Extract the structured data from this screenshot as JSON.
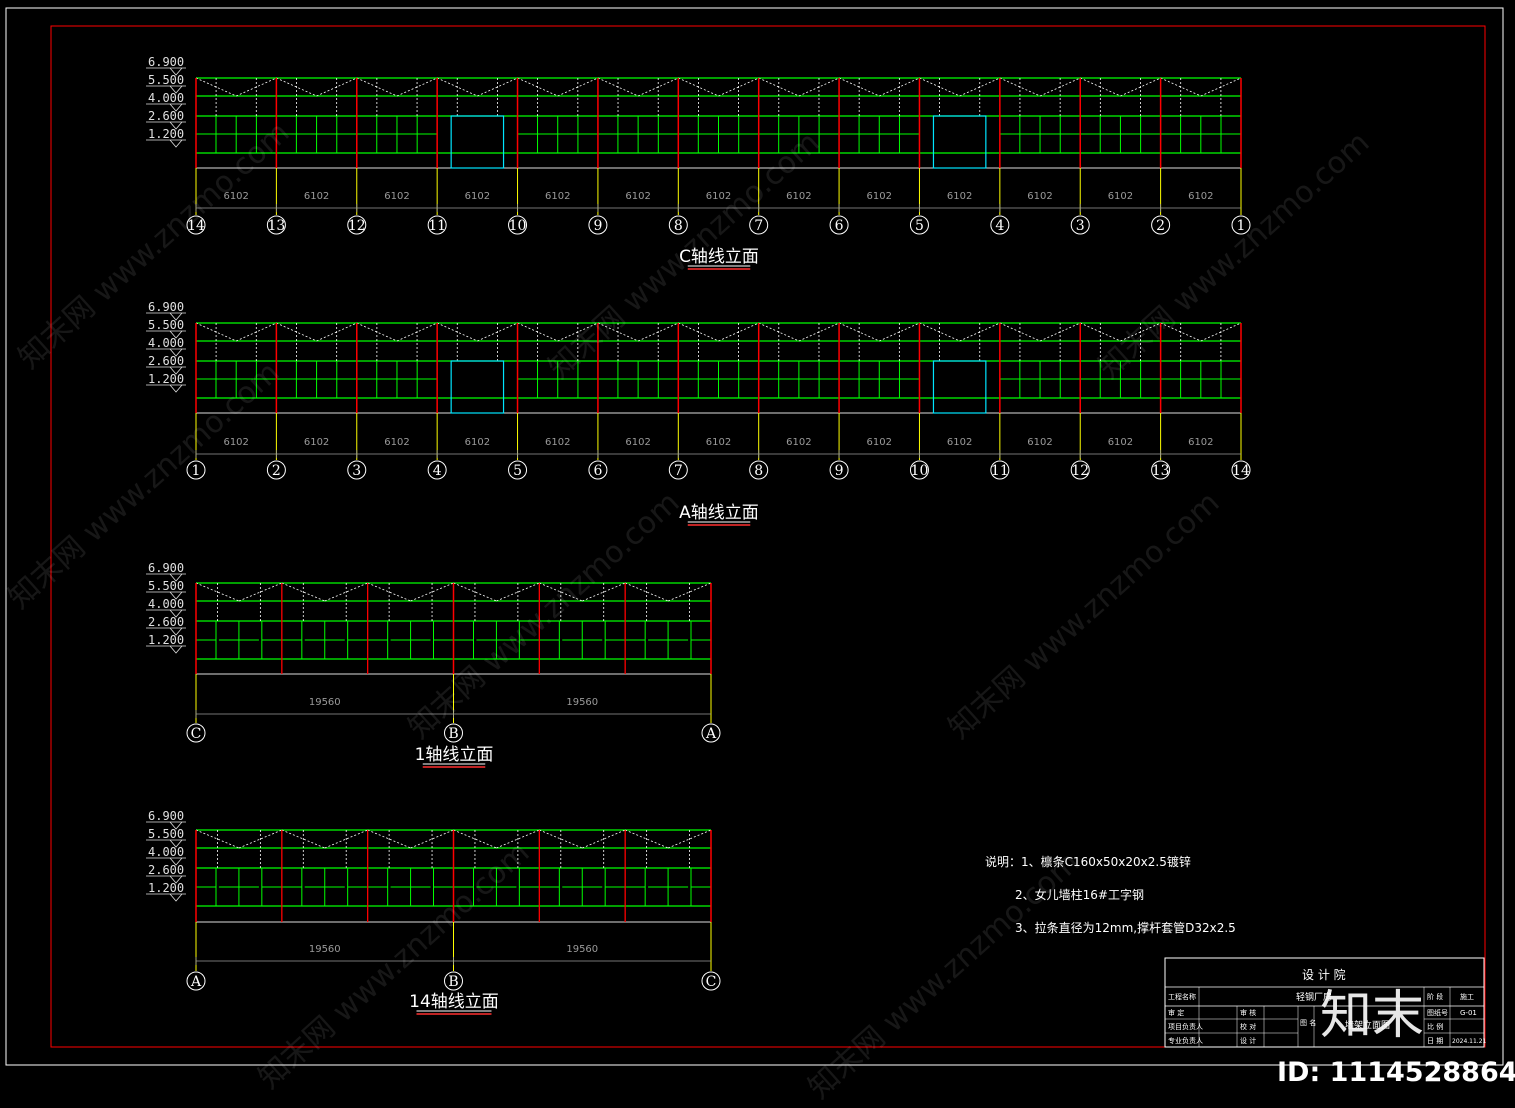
{
  "drawings": [
    {
      "id": "c",
      "title": "C轴线立面",
      "elevations": [
        "6.900",
        "5.500",
        "4.000",
        "2.600",
        "1.200"
      ],
      "axes": [
        "14",
        "13",
        "12",
        "11",
        "10",
        "9",
        "8",
        "7",
        "6",
        "5",
        "4",
        "3",
        "2",
        "1"
      ],
      "dimensions": [
        "6102",
        "6102",
        "6102",
        "6102",
        "6102",
        "6102",
        "6102",
        "6102",
        "6102",
        "6102",
        "6102",
        "6102",
        "6102"
      ],
      "door_bays": [
        3,
        9
      ]
    },
    {
      "id": "a",
      "title": "A轴线立面",
      "elevations": [
        "6.900",
        "5.500",
        "4.000",
        "2.600",
        "1.200"
      ],
      "axes": [
        "1",
        "2",
        "3",
        "4",
        "5",
        "6",
        "7",
        "8",
        "9",
        "10",
        "11",
        "12",
        "13",
        "14"
      ],
      "dimensions": [
        "6102",
        "6102",
        "6102",
        "6102",
        "6102",
        "6102",
        "6102",
        "6102",
        "6102",
        "6102",
        "6102",
        "6102",
        "6102"
      ],
      "door_bays": [
        3,
        9
      ]
    },
    {
      "id": "g1",
      "title": "1轴线立面",
      "elevations": [
        "6.900",
        "5.500",
        "4.000",
        "2.600",
        "1.200"
      ],
      "axes": [
        "C",
        "B",
        "A"
      ],
      "dimensions": [
        "19560",
        "19560"
      ],
      "door_bays": []
    },
    {
      "id": "g14",
      "title": "14轴线立面",
      "elevations": [
        "6.900",
        "5.500",
        "4.000",
        "2.600",
        "1.200"
      ],
      "axes": [
        "A",
        "B",
        "C"
      ],
      "dimensions": [
        "19560",
        "19560"
      ],
      "door_bays": []
    }
  ],
  "notes": {
    "n1": "说明：1、檩条C160x50x20x2.5镀锌",
    "n2": "2、女儿墙柱16#工字钢",
    "n3": "3、拉条直径为12mm,撑杆套管D32x2.5"
  },
  "title_block": {
    "institute": "设 计 院",
    "project_label": "工程名称",
    "project_name": "轻钢厂房",
    "review": "审 定",
    "check": "审 核",
    "proj_lead": "项目负责人",
    "proofread": "校 对",
    "pro_lead": "专业负责人",
    "design": "设 计",
    "drawing_label": "图 名",
    "drawing_name": "墙架立面图",
    "phase_label": "阶 段",
    "phase": "施工",
    "no_label": "图纸号",
    "no": "G-01",
    "scale_label": "比 例",
    "date_label": "日 期",
    "date": "2024.11.21"
  },
  "watermark": {
    "text": "知末网 www.znzmo.com",
    "brand": "知末",
    "id_text": "ID: 1114528864"
  },
  "colors": {
    "frame_red": "#ff0000",
    "steel_green": "#00ff00",
    "column_red": "#ff0000",
    "truss_white": "#ffffff",
    "axis_yellow": "#ffff00",
    "door_cyan": "#00e5ff"
  }
}
